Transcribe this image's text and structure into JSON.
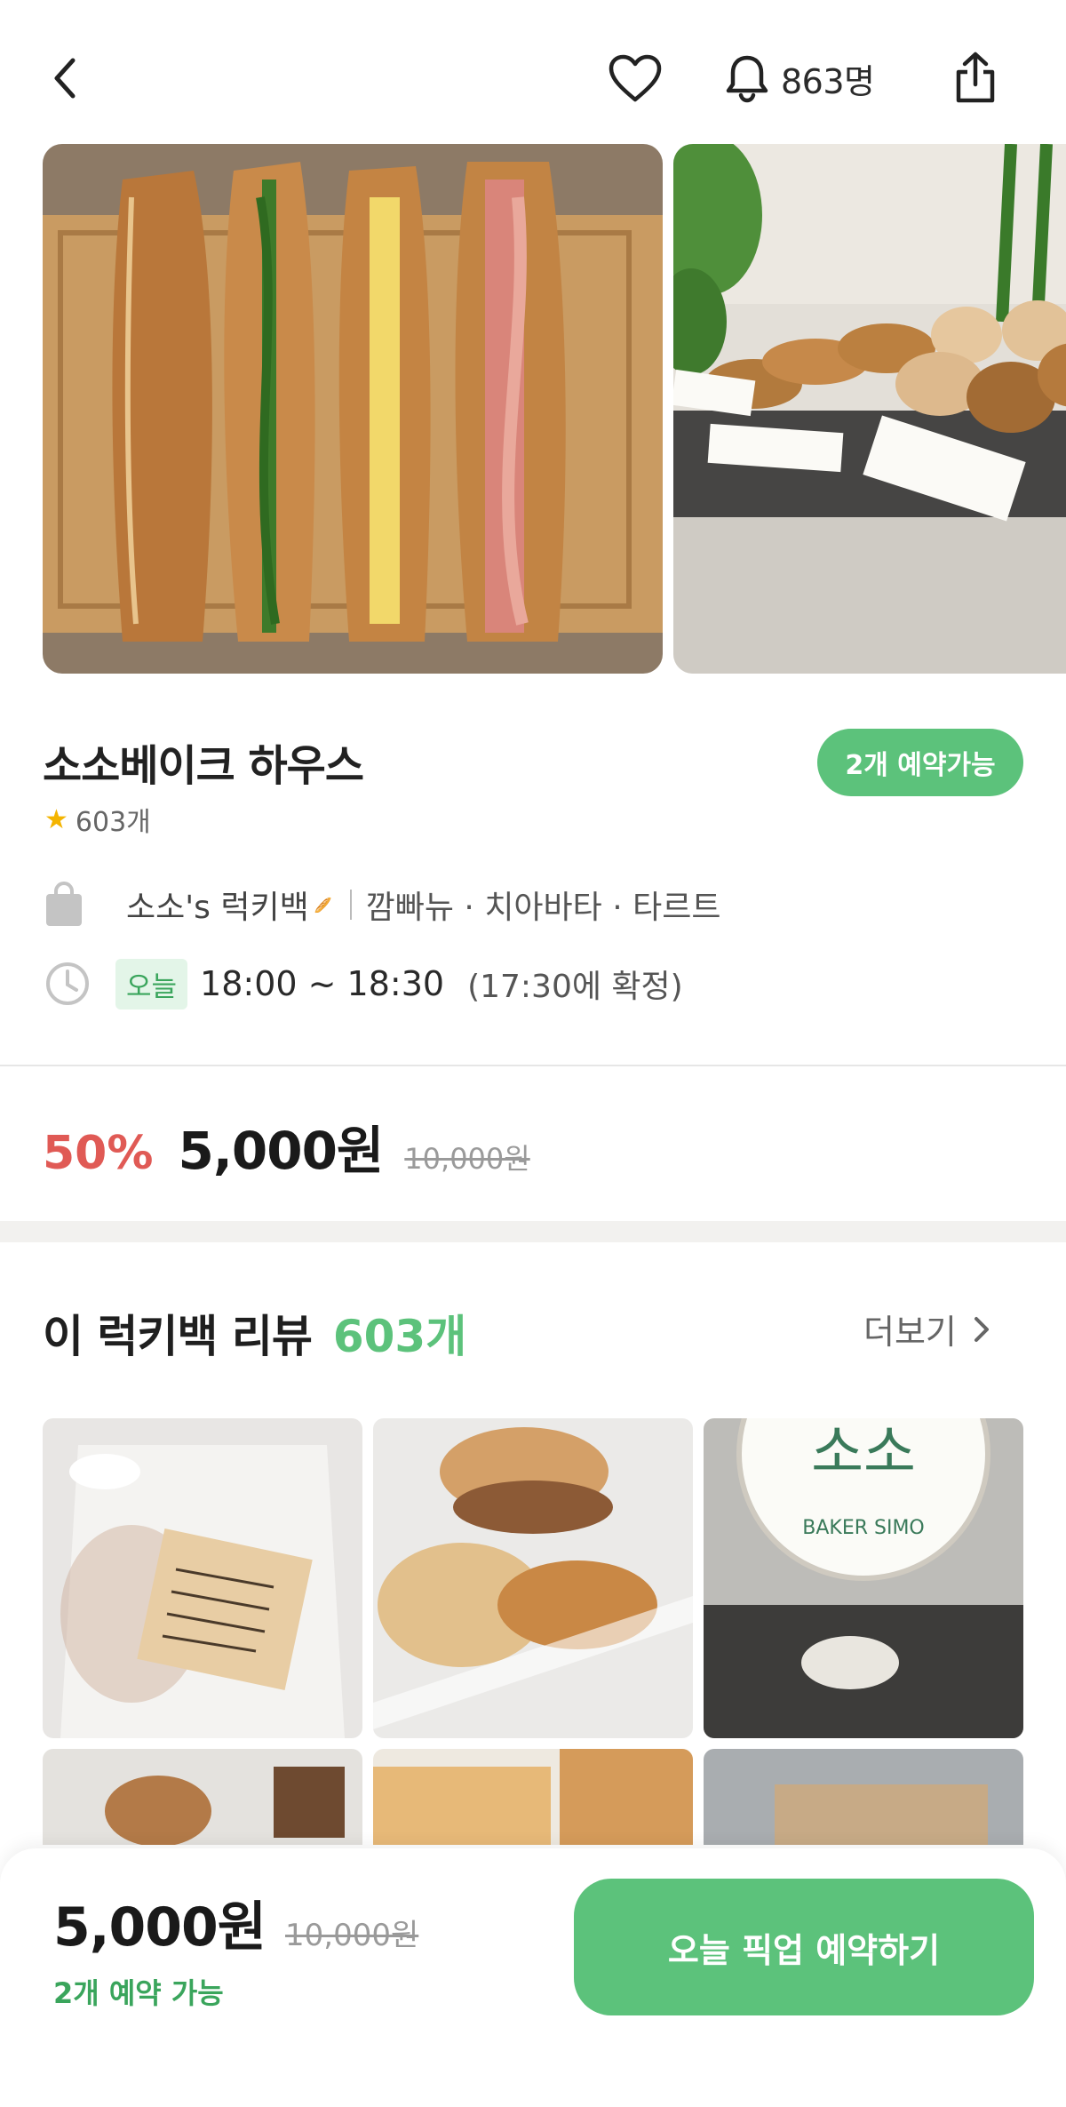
{
  "header": {
    "subscriber_count": "863명"
  },
  "store": {
    "name": "소소베이크 하우스",
    "reserve_badge": "2개 예약가능",
    "review_count": "603개"
  },
  "bag": {
    "name": "소소's 럭키백",
    "emoji": "🥖",
    "menu": "깜빠뉴 · 치아바타 · 타르트"
  },
  "pickup": {
    "day_badge": "오늘",
    "time": "18:00 ~ 18:30",
    "confirm": "(17:30에 확정)"
  },
  "pricing": {
    "discount": "50%",
    "price": "5,000원",
    "original_price": "10,000원"
  },
  "reviews": {
    "title": "이 럭키백 리뷰",
    "count": "603개",
    "more_label": "더보기"
  },
  "photo_text": {
    "bakery_sign_top": "소소",
    "bakery_sign_bottom": "BAKER SIMO"
  },
  "bottom_bar": {
    "price": "5,000원",
    "original_price": "10,000원",
    "availability": "2개 예약 가능",
    "cta_label": "오늘 픽업 예약하기"
  },
  "colors": {
    "accent_green": "#5cc27b",
    "discount_red": "#e05a55"
  },
  "icons": [
    "chevron-left-icon",
    "heart-icon",
    "bell-icon",
    "share-icon",
    "shopping-bag-icon",
    "clock-icon",
    "star-icon",
    "chevron-right-icon"
  ]
}
